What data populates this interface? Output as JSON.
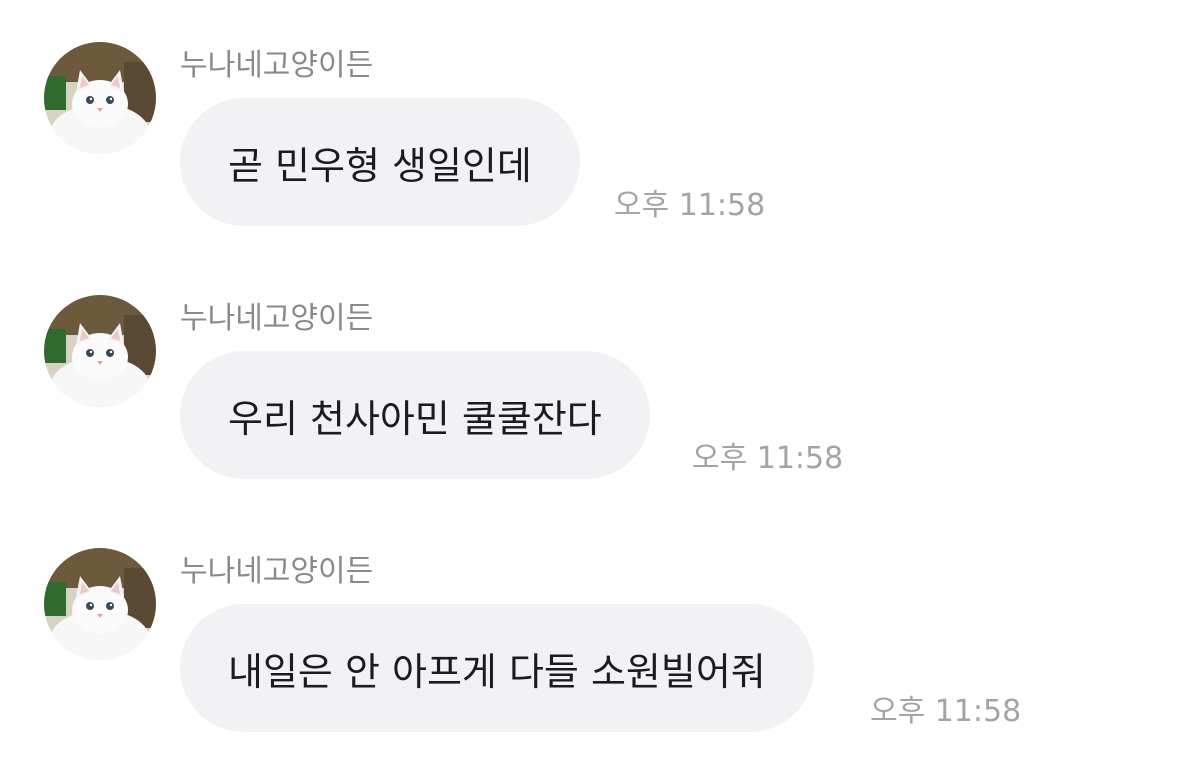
{
  "messages": [
    {
      "sender": "누나네고양이든",
      "avatar_icon": "white-cat-avatar",
      "text": "곧 민우형 생일인데",
      "time": "오후 11:58"
    },
    {
      "sender": "누나네고양이든",
      "avatar_icon": "white-cat-avatar",
      "text": "우리 천사아민 쿨쿨잔다",
      "time": "오후 11:58"
    },
    {
      "sender": "누나네고양이든",
      "avatar_icon": "white-cat-avatar",
      "text": "내일은 안 아프게 다들 소원빌어줘",
      "time": "오후 11:58"
    }
  ],
  "colors": {
    "bubble_background": "#f2f2f5",
    "message_text": "#1c1c1e",
    "sender_text": "#8a8a8e",
    "time_text": "#a3a3a8"
  }
}
